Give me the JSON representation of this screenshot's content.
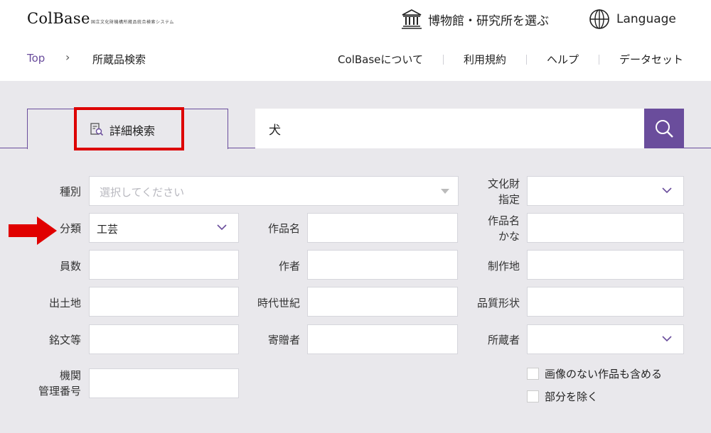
{
  "header": {
    "logo": "ColBase",
    "logo_sub": "国立文化財機構所蔵品統合検索システム",
    "museum_label": "博物館・研究所を選ぶ",
    "language_label": "Language",
    "breadcrumb": {
      "top": "Top",
      "separator": "›",
      "current": "所蔵品検索"
    },
    "nav": [
      "ColBaseについて",
      "利用規約",
      "ヘルプ",
      "データセット"
    ]
  },
  "search": {
    "tab_label": "詳細検索",
    "query": "犬"
  },
  "form": {
    "shubetsu": {
      "label": "種別",
      "placeholder": "選択してください"
    },
    "bunkazai": {
      "label_line1": "文化財",
      "label_line2": "指定",
      "value": ""
    },
    "bunrui": {
      "label": "分類",
      "value": "工芸"
    },
    "sakuhinmei": {
      "label": "作品名",
      "value": ""
    },
    "sakuhinmei_kana": {
      "label_line1": "作品名",
      "label_line2": "かな",
      "value": ""
    },
    "insu": {
      "label": "員数",
      "value": ""
    },
    "sakusha": {
      "label": "作者",
      "value": ""
    },
    "seisakuchi": {
      "label": "制作地",
      "value": ""
    },
    "shutsudochi": {
      "label": "出土地",
      "value": ""
    },
    "jidai": {
      "label": "時代世紀",
      "value": ""
    },
    "hinshitsu": {
      "label": "品質形状",
      "value": ""
    },
    "meibun": {
      "label": "銘文等",
      "value": ""
    },
    "kizousha": {
      "label": "寄贈者",
      "value": ""
    },
    "shozousha": {
      "label": "所蔵者",
      "value": ""
    },
    "kikan": {
      "label_line1": "機関",
      "label_line2": "管理番号",
      "value": ""
    },
    "checkbox_include_no_image": {
      "label": "画像のない作品も含める",
      "checked": false
    },
    "checkbox_exclude_parts": {
      "label": "部分を除く",
      "checked": false
    }
  },
  "colors": {
    "accent": "#6a4d9c",
    "highlight": "#dd0000",
    "background": "#e9e8ec"
  }
}
